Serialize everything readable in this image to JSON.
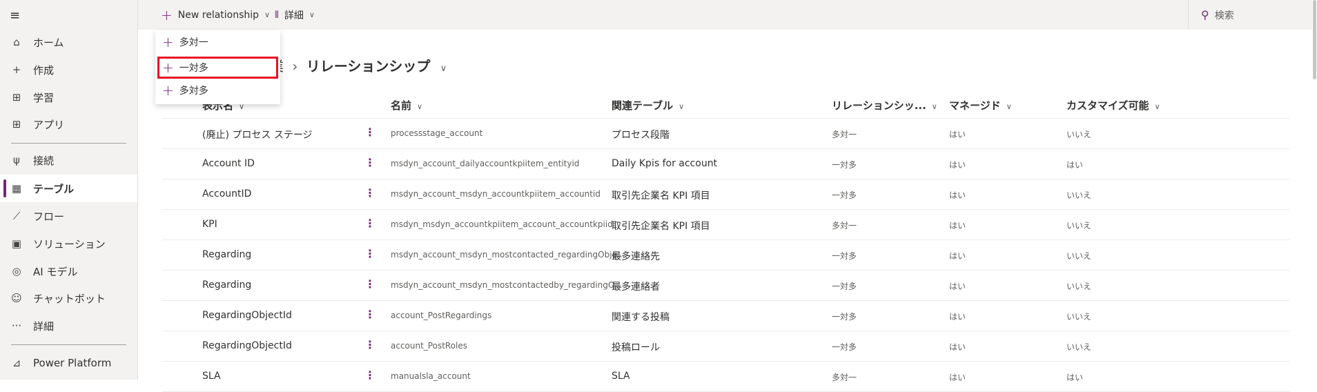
{
  "sidebar": {
    "items": [
      {
        "icon": "home-icon",
        "glyph": "⌂",
        "label": "ホーム"
      },
      {
        "icon": "plus-icon",
        "glyph": "+",
        "label": "作成"
      },
      {
        "icon": "book-icon",
        "glyph": "⊞",
        "label": "学習"
      },
      {
        "icon": "apps-icon",
        "glyph": "⊞",
        "label": "アプリ"
      },
      {
        "icon": "plug-icon",
        "glyph": "ψ",
        "label": "接続"
      },
      {
        "icon": "table-icon",
        "glyph": "▦",
        "label": "テーブル",
        "selected": true
      },
      {
        "icon": "flow-icon",
        "glyph": "⟋",
        "label": "フロー"
      },
      {
        "icon": "solution-icon",
        "glyph": "▣",
        "label": "ソリューション"
      },
      {
        "icon": "brain-icon",
        "glyph": "◎",
        "label": "AI モデル"
      },
      {
        "icon": "bot-icon",
        "glyph": "☺",
        "label": "チャットボット"
      },
      {
        "icon": "more-icon",
        "glyph": "···",
        "label": "詳細"
      },
      {
        "icon": "power-platform-icon",
        "glyph": "⊿",
        "label": "Power Platform"
      }
    ]
  },
  "toolbar": {
    "new_relationship": "New relationship",
    "more": "詳細",
    "search": "検索"
  },
  "menu": {
    "items": [
      "多対一",
      "一対多",
      "多対多"
    ],
    "highlighted": 1
  },
  "breadcrumb": {
    "parent": "企業",
    "current": "リレーションシップ"
  },
  "table": {
    "columns": [
      "表示名",
      "名前",
      "関連テーブル",
      "リレーションシッ...",
      "マネージド",
      "カスタマイズ可能"
    ],
    "rows": [
      [
        "(廃止) プロセス ステージ",
        "processstage_account",
        "プロセス段階",
        "多対一",
        "はい",
        "いいえ"
      ],
      [
        "Account ID",
        "msdyn_account_dailyaccountkpiitem_entityid",
        "Daily Kpis for account",
        "一対多",
        "はい",
        "はい"
      ],
      [
        "AccountID",
        "msdyn_account_msdyn_accountkpiitem_accountid",
        "取引先企業名 KPI 項目",
        "一対多",
        "はい",
        "いいえ"
      ],
      [
        "KPI",
        "msdyn_msdyn_accountkpiitem_account_accountkpiid",
        "取引先企業名 KPI 項目",
        "多対一",
        "はい",
        "いいえ"
      ],
      [
        "Regarding",
        "msdyn_account_msdyn_mostcontacted_regardingObje...",
        "最多連絡先",
        "一対多",
        "はい",
        "いいえ"
      ],
      [
        "Regarding",
        "msdyn_account_msdyn_mostcontactedby_regardingO...",
        "最多連絡者",
        "一対多",
        "はい",
        "いいえ"
      ],
      [
        "RegardingObjectId",
        "account_PostRegardings",
        "関連する投稿",
        "一対多",
        "はい",
        "いいえ"
      ],
      [
        "RegardingObjectId",
        "account_PostRoles",
        "投稿ロール",
        "一対多",
        "はい",
        "いいえ"
      ],
      [
        "SLA",
        "manualsla_account",
        "SLA",
        "多対一",
        "はい",
        "はい"
      ]
    ]
  },
  "colors": {
    "accent": "#742774",
    "highlight": "#e81123"
  }
}
